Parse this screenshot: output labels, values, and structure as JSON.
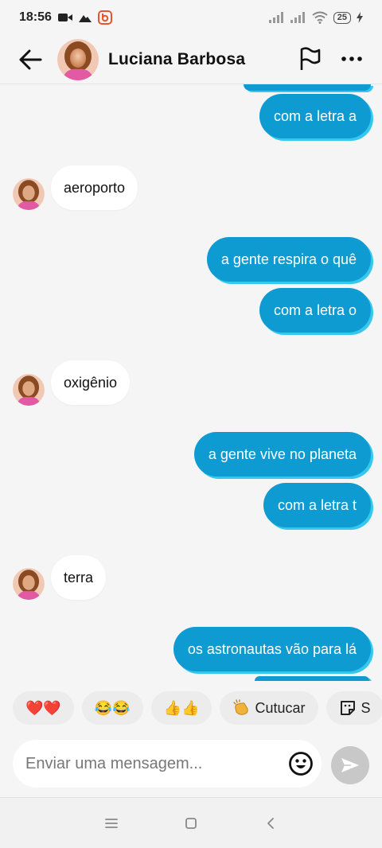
{
  "status_bar": {
    "time": "18:56",
    "battery": "25"
  },
  "header": {
    "contact_name": "Luciana Barbosa"
  },
  "messages": [
    {
      "direction": "outgoing",
      "text": "com a letra a"
    },
    {
      "direction": "incoming",
      "text": "aeroporto"
    },
    {
      "direction": "outgoing",
      "text": "a gente respira o quê"
    },
    {
      "direction": "outgoing",
      "text": "com a letra o"
    },
    {
      "direction": "incoming",
      "text": "oxigênio"
    },
    {
      "direction": "outgoing",
      "text": "a gente vive no planeta"
    },
    {
      "direction": "outgoing",
      "text": "com a letra t"
    },
    {
      "direction": "incoming",
      "text": "terra"
    },
    {
      "direction": "outgoing",
      "text": "os astronautas vão para lá"
    }
  ],
  "quick_replies": [
    {
      "label": "❤️❤️",
      "icon": "hearts"
    },
    {
      "label": "😂😂",
      "icon": "laughing"
    },
    {
      "label": "👍👍",
      "icon": "thumbs-up"
    },
    {
      "label": "Cutucar",
      "icon": "clap-hand"
    },
    {
      "label": "S",
      "icon": "sticker"
    }
  ],
  "composer": {
    "placeholder": "Enviar uma mensagem..."
  },
  "colors": {
    "outgoing_bubble": "#0d9bd2",
    "outgoing_shadow": "#35c7ee",
    "incoming_bubble": "#ffffff",
    "background": "#f5f5f5"
  }
}
